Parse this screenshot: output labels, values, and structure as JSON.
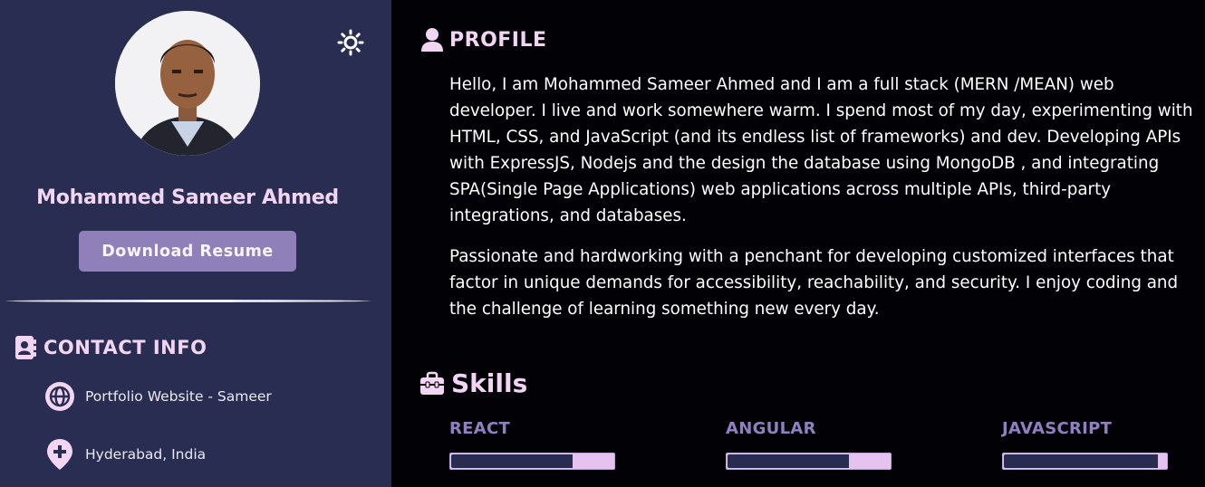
{
  "sidebar": {
    "name": "Mohammed Sameer Ahmed",
    "resume_button": "Download Resume",
    "theme_icon": "sun-icon",
    "contact": {
      "heading": "CONTACT INFO",
      "items": [
        {
          "icon": "globe-icon",
          "text": "Portfolio Website - Sameer"
        },
        {
          "icon": "location-pin-icon",
          "text": "Hyderabad, India"
        }
      ]
    }
  },
  "main": {
    "profile": {
      "heading": "PROFILE",
      "paragraphs": [
        "Hello, I am Mohammed Sameer Ahmed and I am a full stack (MERN /MEAN) web developer. I live and work somewhere warm. I spend most of my day, experimenting with HTML, CSS, and JavaScript (and its endless list of frameworks) and dev. Developing APIs with ExpressJS, Nodejs and the design the database using MongoDB , and integrating SPA(Single Page Applications) web applications across multiple APIs, third-party integrations, and databases.",
        "Passionate and hardworking with a penchant for developing customized interfaces that factor in unique demands for accessibility, reachability, and security. I enjoy coding and the challenge of learning something new every day."
      ]
    },
    "skills": {
      "heading": "Skills",
      "items": [
        {
          "label": "REACT",
          "level": 0.75
        },
        {
          "label": "ANGULAR",
          "level": 0.75
        },
        {
          "label": "JAVASCRIPT",
          "level": 0.95
        }
      ]
    }
  },
  "colors": {
    "sidebar_bg": "#292d52",
    "main_bg": "#020106",
    "accent_pink": "#f1d5f2",
    "accent_purple": "#9080b9"
  }
}
